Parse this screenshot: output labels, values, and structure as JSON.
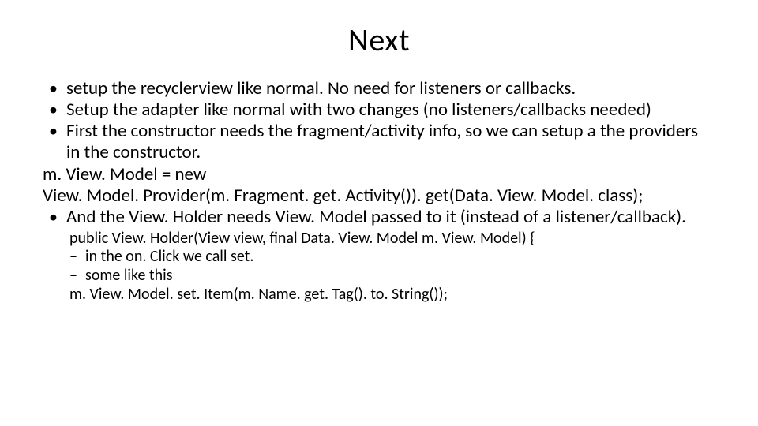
{
  "title": "Next",
  "bullets": {
    "b1": "setup the recyclerview like normal.  No need for listeners or callbacks.",
    "b2": "Setup the adapter like normal with two changes (no listeners/callbacks needed)",
    "b3": "First the constructor needs the fragment/activity info, so we can setup a the providers in the constructor.",
    "code1a": "m. View. Model = new",
    "code1b": "View. Model. Provider(m. Fragment. get. Activity()). get(Data. View. Model. class);",
    "b4": "And the View. Holder needs View. Model passed to it (instead of a listener/callback)."
  },
  "sub": {
    "s1": "public View. Holder(View view, final Data. View. Model m. View. Model) {",
    "s2": "in the on. Click we call set.",
    "s3": "some like this",
    "s4": "m. View. Model. set. Item(m. Name. get. Tag(). to. String());"
  }
}
